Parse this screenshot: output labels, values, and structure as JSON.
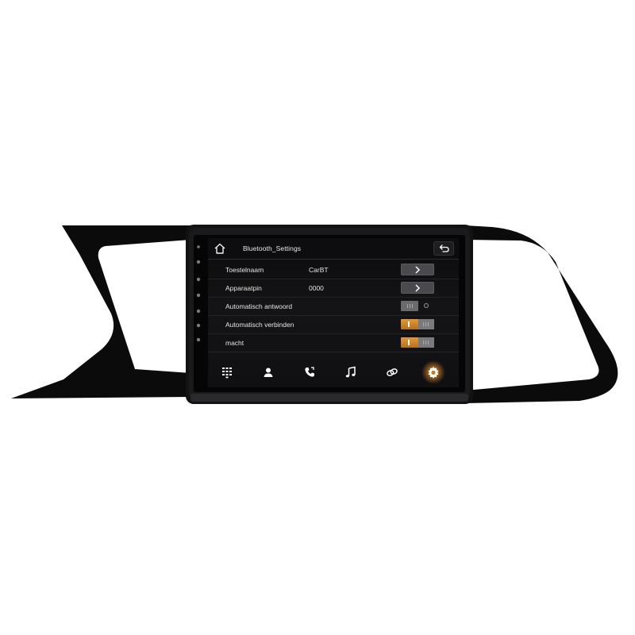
{
  "header": {
    "title": "Bluetooth_Settings",
    "home_icon": "home-icon",
    "back_icon": "back-arrow-icon"
  },
  "settings": [
    {
      "label": "Toestelnaam",
      "value": "CarBT",
      "control": "arrow"
    },
    {
      "label": "Apparaatpin",
      "value": "0000",
      "control": "arrow"
    },
    {
      "label": "Automatisch antwoord",
      "value": "",
      "control": "toggle-off"
    },
    {
      "label": "Automatisch verbinden",
      "value": "",
      "control": "toggle-on"
    },
    {
      "label": "macht",
      "value": "",
      "control": "toggle-on"
    }
  ],
  "tabs": [
    {
      "icon": "dialpad-icon"
    },
    {
      "icon": "contacts-icon"
    },
    {
      "icon": "call-log-icon"
    },
    {
      "icon": "music-icon"
    },
    {
      "icon": "link-icon"
    },
    {
      "icon": "settings-icon",
      "active": true
    }
  ],
  "colors": {
    "accent": "#e8962f",
    "screen_bg": "#101012",
    "bezel": "#0a0a0a"
  }
}
